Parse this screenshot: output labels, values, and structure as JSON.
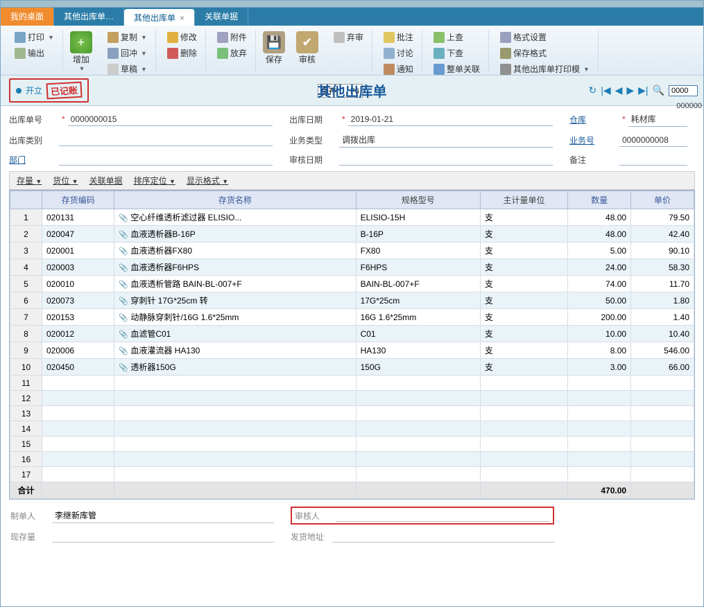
{
  "tabs": [
    {
      "label": "我的桌面",
      "active": false,
      "orange": true
    },
    {
      "label": "其他出库单…",
      "active": false
    },
    {
      "label": "其他出库单",
      "active": true,
      "closable": true
    },
    {
      "label": "关联单据",
      "active": false
    }
  ],
  "toolbar": {
    "print": "打印",
    "export": "输出",
    "add": "增加",
    "copy": "复制",
    "undo": "回冲",
    "draft": "草稿",
    "edit": "修改",
    "del": "删除",
    "attach": "附件",
    "play": "放弃",
    "save": "保存",
    "audit": "审核",
    "cancel": "弃审",
    "note": "批注",
    "chat": "讨论",
    "notify": "通知",
    "up": "上查",
    "down": "下查",
    "link": "整单关联",
    "fmt": "格式设置",
    "savefmt": "保存格式",
    "tpl": "其他出库单打印模"
  },
  "docheader": {
    "status": "开立",
    "stamp": "已记账",
    "title": "其他出库单",
    "hint_label": "保存",
    "hint_key": "F6",
    "search_val": "0000",
    "overflow": "000000"
  },
  "form": {
    "doc_no_lbl": "出库单号",
    "doc_no": "0000000015",
    "date_lbl": "出库日期",
    "date": "2019-01-21",
    "wh_lbl": "仓库",
    "wh": "耗材库",
    "type_lbl": "出库类别",
    "type": "",
    "biz_lbl": "业务类型",
    "biz": "调拨出库",
    "bizno_lbl": "业务号",
    "bizno": "0000000008",
    "dept_lbl": "部门",
    "dept": "",
    "audit_date_lbl": "审核日期",
    "audit_date": "",
    "remark_lbl": "备注",
    "remark": ""
  },
  "subbar": {
    "stock": "存量",
    "loc": "货位",
    "rel": "关联单据",
    "sort": "排序定位",
    "fmt": "显示格式"
  },
  "grid": {
    "headers": {
      "row": "",
      "code": "存货编码",
      "name": "存货名称",
      "spec": "规格型号",
      "unit": "主计量单位",
      "qty": "数量",
      "price": "单价"
    },
    "rows": [
      {
        "n": 1,
        "code": "020131",
        "name": "空心纤维透析滤过器 ELISIO...",
        "spec": "ELISIO-15H",
        "unit": "支",
        "qty": "48.00",
        "price": "79.50"
      },
      {
        "n": 2,
        "code": "020047",
        "name": "血液透析器B-16P",
        "spec": "B-16P",
        "unit": "支",
        "qty": "48.00",
        "price": "42.40"
      },
      {
        "n": 3,
        "code": "020001",
        "name": "血液透析器FX80",
        "spec": "FX80",
        "unit": "支",
        "qty": "5.00",
        "price": "90.10"
      },
      {
        "n": 4,
        "code": "020003",
        "name": "血液透析器F6HPS",
        "spec": "F6HPS",
        "unit": "支",
        "qty": "24.00",
        "price": "58.30"
      },
      {
        "n": 5,
        "code": "020010",
        "name": "血液透析管路 BAIN-BL-007+F",
        "spec": "BAIN-BL-007+F",
        "unit": "支",
        "qty": "74.00",
        "price": "11.70"
      },
      {
        "n": 6,
        "code": "020073",
        "name": "穿刺针 17G*25cm 转",
        "spec": "17G*25cm",
        "unit": "支",
        "qty": "50.00",
        "price": "1.80"
      },
      {
        "n": 7,
        "code": "020153",
        "name": "动静脉穿刺针/16G 1.6*25mm",
        "spec": "16G 1.6*25mm",
        "unit": "支",
        "qty": "200.00",
        "price": "1.40"
      },
      {
        "n": 8,
        "code": "020012",
        "name": "血滤管C01",
        "spec": "C01",
        "unit": "支",
        "qty": "10.00",
        "price": "10.40"
      },
      {
        "n": 9,
        "code": "020006",
        "name": "血液灌流器 HA130",
        "spec": "HA130",
        "unit": "支",
        "qty": "8.00",
        "price": "546.00"
      },
      {
        "n": 10,
        "code": "020450",
        "name": "透析器150G",
        "spec": "150G",
        "unit": "支",
        "qty": "3.00",
        "price": "66.00"
      }
    ],
    "empty_rows": [
      11,
      12,
      13,
      14,
      15,
      16,
      17
    ],
    "total_lbl": "合计",
    "total_qty": "470.00"
  },
  "footer": {
    "maker_lbl": "制单人",
    "maker": "李继新库管",
    "auditor_lbl": "审核人",
    "auditor": "",
    "stock_lbl": "现存量",
    "stock": "",
    "addr_lbl": "发货地址",
    "addr": ""
  }
}
